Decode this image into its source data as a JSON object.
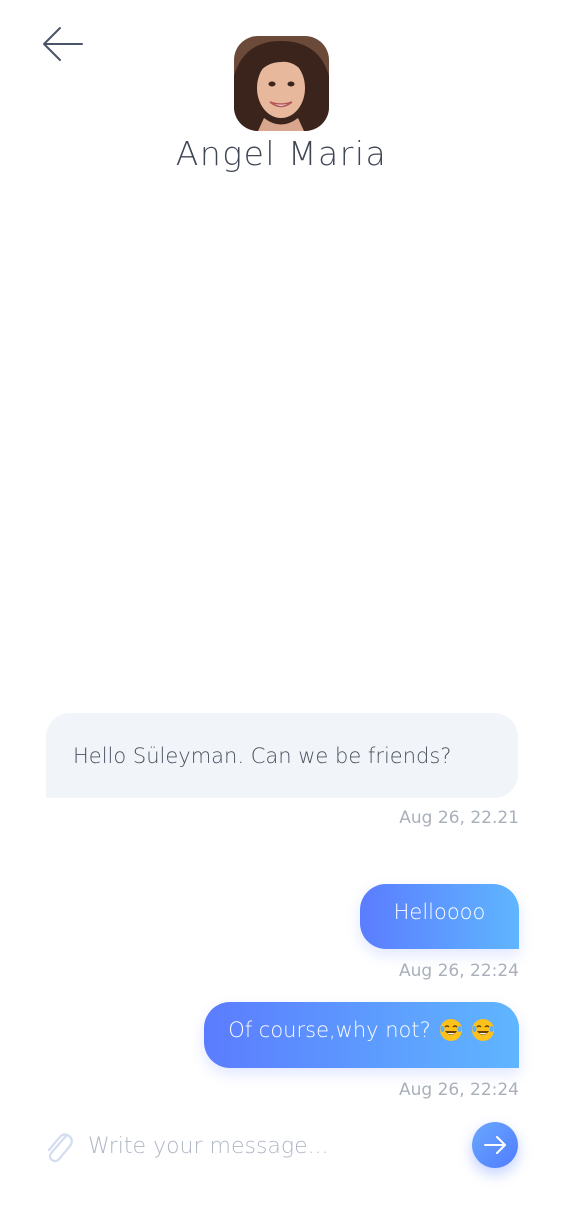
{
  "header": {
    "contact_name": "Angel Maria",
    "back_icon": "arrow-left-icon",
    "avatar_alt": "contact-photo"
  },
  "messages": [
    {
      "direction": "incoming",
      "text": "Hello Süleyman. Can we be friends?",
      "time": "Aug 26, 22.21"
    },
    {
      "direction": "outgoing",
      "text": "Helloooo",
      "time": "Aug 26, 22:24"
    },
    {
      "direction": "outgoing",
      "text": "Of course,why not?",
      "time": "Aug 26, 22:24",
      "emoji": [
        "laughing-crying-emoji",
        "laughing-crying-emoji"
      ]
    }
  ],
  "composer": {
    "placeholder": "Write your message...",
    "value": "",
    "attach_icon": "paperclip-icon",
    "send_icon": "arrow-right-icon"
  },
  "colors": {
    "outgoing_start": "#5b7cff",
    "outgoing_end": "#5fb6ff",
    "incoming_bg": "#f1f4f8",
    "timestamp": "#a9b0bb"
  }
}
